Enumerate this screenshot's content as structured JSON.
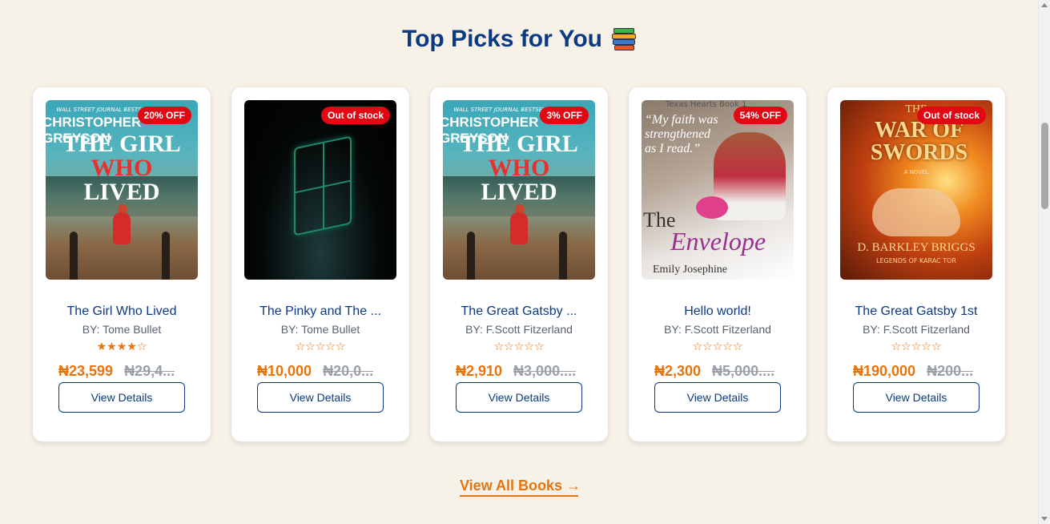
{
  "section": {
    "title": "Top Picks for You",
    "icon": "books-icon"
  },
  "books": [
    {
      "title": "The Girl Who Lived",
      "author": "BY: Tome Bullet",
      "rating": 4,
      "price": "₦23,599",
      "old_price": "₦29,4...",
      "badge": "20% OFF",
      "button": "View Details",
      "cover": {
        "line1": "WALL STREET JOURNAL BESTSELLING AUTHOR",
        "line2": "CHRISTOPHER GREYSON",
        "title_a": "THE GIRL",
        "title_b": "WHO",
        "title_c": "LIVED"
      }
    },
    {
      "title": "The Pinky and The ...",
      "author": "BY: Tome Bullet",
      "rating": 0,
      "price": "₦10,000",
      "old_price": "₦20,0...",
      "badge": "Out of stock",
      "button": "View Details"
    },
    {
      "title": "The Great Gatsby ...",
      "author": "BY: F.Scott Fitzerland",
      "rating": 0,
      "price": "₦2,910",
      "old_price": "₦3,000....",
      "badge": "3% OFF",
      "button": "View Details",
      "cover": {
        "line1": "WALL STREET JOURNAL BESTSELLING AUTHOR",
        "line2": "CHRISTOPHER GREYSON",
        "title_a": "THE GIRL",
        "title_b": "WHO",
        "title_c": "LIVED"
      }
    },
    {
      "title": "Hello world!",
      "author": "BY: F.Scott Fitzerland",
      "rating": 0,
      "price": "₦2,300",
      "old_price": "₦5,000....",
      "badge": "54% OFF",
      "button": "View Details",
      "cover": {
        "series": "Texas Hearts Book 1",
        "quote": "“My faith was strengthened as I read.”",
        "the": "The",
        "title": "Envelope",
        "author": "Emily Josephine"
      }
    },
    {
      "title": "The Great Gatsby 1st",
      "author": "BY: F.Scott Fitzerland",
      "rating": 0,
      "price": "₦190,000",
      "old_price": "₦200...",
      "badge": "Out of stock",
      "button": "View Details",
      "cover": {
        "top": "THE",
        "title": "WAR OF SWORDS",
        "sub": "A NOVEL",
        "author": "D. BARKLEY BRIGGS",
        "series": "LEGENDS OF KARAC TOR"
      }
    }
  ],
  "view_all": "View All Books →",
  "colors": {
    "background": "#f7f2e8",
    "heading": "#0b3a82",
    "accent": "#e8730c",
    "badge": "#e30613"
  }
}
